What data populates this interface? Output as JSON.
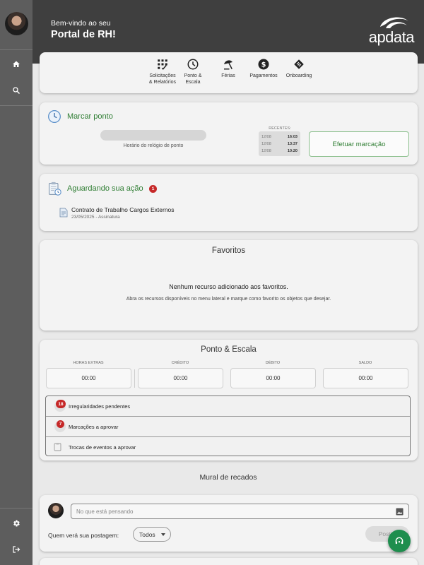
{
  "header": {
    "welcome": "Bem-vindo ao seu",
    "portal": "Portal de RH!",
    "logo_text": "apdata"
  },
  "sidebar": {
    "icons": [
      "avatar",
      "home-icon",
      "search-icon",
      "gear-icon",
      "logout-icon"
    ]
  },
  "menu": {
    "items": [
      {
        "line1": "Solicitações",
        "line2": "& Relatórios",
        "icon": "grid-icon"
      },
      {
        "line1": "Ponto &",
        "line2": "Escala",
        "icon": "clock-icon"
      },
      {
        "line1": "Férias",
        "line2": "",
        "icon": "umbrella-icon"
      },
      {
        "line1": "Pagamentos",
        "line2": "",
        "icon": "dollar-icon"
      },
      {
        "line1": "Onboarding",
        "line2": "",
        "icon": "onboarding-icon"
      }
    ]
  },
  "marcar_ponto": {
    "title": "Marcar ponto",
    "clock_caption": "Horário do relógio de ponto",
    "recent_label": "RECENTES:",
    "recents": [
      {
        "date": "12/08",
        "time": "16:03"
      },
      {
        "date": "12/08",
        "time": "13:37"
      },
      {
        "date": "12/08",
        "time": "10:20"
      }
    ],
    "button": "Efetuar marcação"
  },
  "aguardando": {
    "title": "Aguardando sua ação",
    "count": "1",
    "item_title": "Contrato de Trabalho Cargos Externos",
    "item_sub": "23/05/2025 - Assinatura"
  },
  "favoritos": {
    "title": "Favoritos",
    "empty": "Nenhum recurso adicionado aos favoritos.",
    "hint": "Abra os recursos disponíveis no menu lateral e marque como favorito os objetos que desejar."
  },
  "ponto_escala": {
    "title": "Ponto & Escala",
    "columns": [
      {
        "label": "HORAS EXTRAS",
        "value": "00:00"
      },
      {
        "label": "CRÉDITO",
        "value": "00:00"
      },
      {
        "label": "DÉBITO",
        "value": "00:00"
      },
      {
        "label": "SALDO",
        "value": "00:00"
      }
    ],
    "rows": [
      {
        "count": "18",
        "label": "Irregularidades pendentes"
      },
      {
        "count": "7",
        "label": "Marcações a aprovar"
      },
      {
        "count": "",
        "label": "Trocas de eventos a aprovar"
      }
    ]
  },
  "mural": {
    "title": "Mural de recados",
    "placeholder": "No que está pensando",
    "visibility_label": "Quem verá sua postagem:",
    "visibility_value": "Todos",
    "post_button": "Postar"
  },
  "colors": {
    "accent_green": "#2e7d32",
    "badge_red": "#c62828",
    "fab_green": "#1e8e4e"
  }
}
